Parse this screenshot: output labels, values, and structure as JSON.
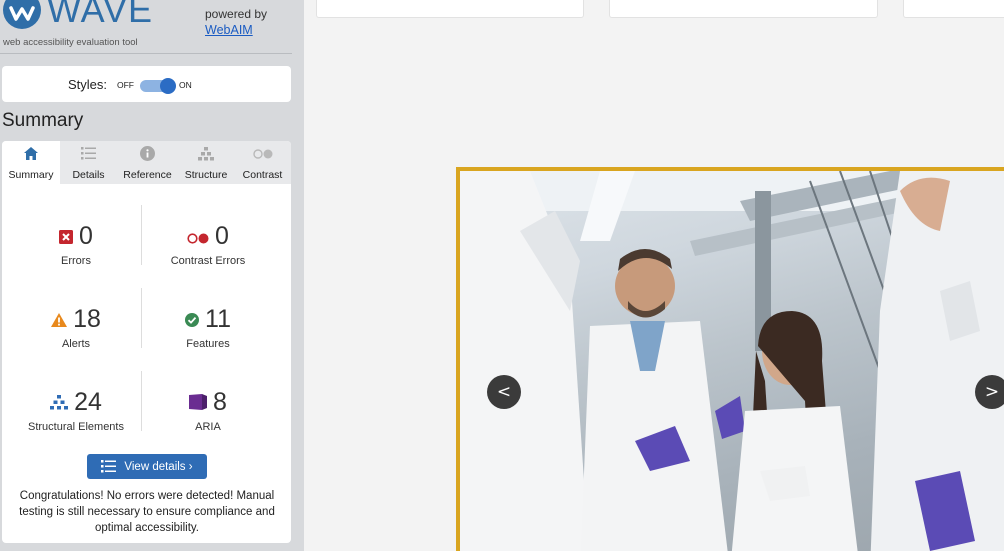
{
  "wave": {
    "logo_text": "WAVE",
    "tagline": "web accessibility evaluation tool",
    "powered_by": "powered by",
    "webaim_link": "WebAIM",
    "styles_label": "Styles:",
    "styles_off": "OFF",
    "styles_on": "ON",
    "summary_heading": "Summary",
    "tabs": [
      {
        "label": "Summary",
        "icon": "home-icon"
      },
      {
        "label": "Details",
        "icon": "list-icon"
      },
      {
        "label": "Reference",
        "icon": "info-icon"
      },
      {
        "label": "Structure",
        "icon": "structure-icon"
      },
      {
        "label": "Contrast",
        "icon": "contrast-icon"
      }
    ],
    "active_tab": "Summary",
    "stats": {
      "errors": {
        "value": "0",
        "label": "Errors"
      },
      "contrast_errors": {
        "value": "0",
        "label": "Contrast Errors"
      },
      "alerts": {
        "value": "18",
        "label": "Alerts"
      },
      "features": {
        "value": "11",
        "label": "Features"
      },
      "structural": {
        "value": "24",
        "label": "Structural Elements"
      },
      "aria": {
        "value": "8",
        "label": "ARIA"
      }
    },
    "view_details": "View details ›",
    "congrats": "Congratulations! No errors were detected! Manual testing is still necessary to ensure compliance and optimal accessibility."
  },
  "carousel": {
    "prev": "<",
    "next": ">"
  },
  "colors": {
    "brand_blue": "#2f6ea8",
    "error_red": "#c4262e",
    "alert_orange": "#e8891d",
    "feature_green": "#3a8a54",
    "aria_purple": "#6a2c91",
    "hero_border": "#d9a520"
  }
}
